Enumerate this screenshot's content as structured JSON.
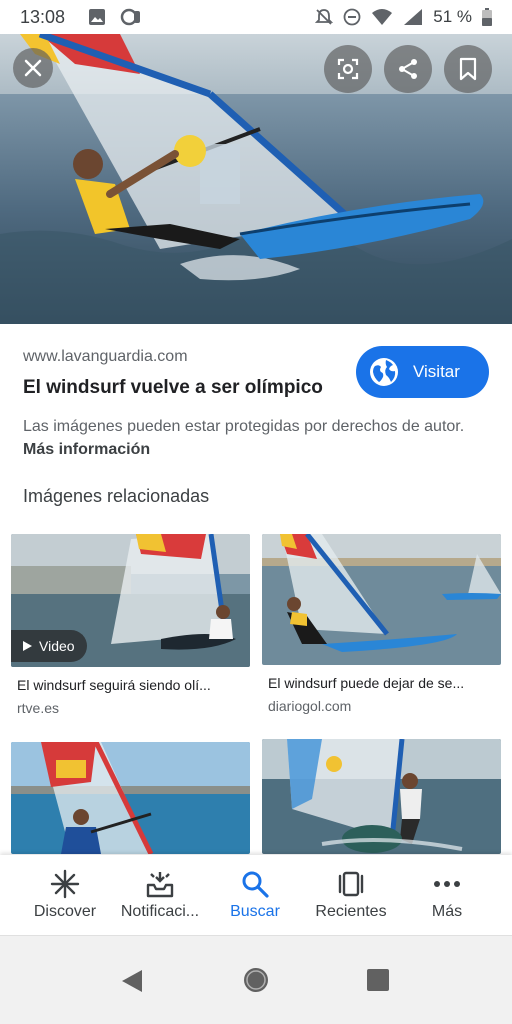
{
  "status_bar": {
    "time": "13:08",
    "battery_percent": "51 %"
  },
  "viewer": {
    "close_icon": "close-icon",
    "actions": [
      "lens-icon",
      "share-icon",
      "bookmark-icon"
    ]
  },
  "result": {
    "source": "www.lavanguardia.com",
    "title": "El windsurf vuelve a ser olímpico",
    "visit_label": "Visitar",
    "copyright_text": "Las imágenes pueden estar protegidas por derechos de autor.",
    "more_info_label": "Más información"
  },
  "related": {
    "heading": "Imágenes relacionadas",
    "items": [
      {
        "title": "El windsurf seguirá siendo olí...",
        "source": "rtve.es",
        "badge": "Video"
      },
      {
        "title": "El windsurf puede dejar de se...",
        "source": "diariogol.com"
      },
      {
        "title": "",
        "source": ""
      },
      {
        "title": "",
        "source": ""
      }
    ]
  },
  "bottom_nav": {
    "items": [
      {
        "label": "Discover",
        "icon": "discover-icon"
      },
      {
        "label": "Notificaci...",
        "icon": "notifications-icon"
      },
      {
        "label": "Buscar",
        "icon": "search-icon",
        "active": true
      },
      {
        "label": "Recientes",
        "icon": "recents-icon"
      },
      {
        "label": "Más",
        "icon": "more-icon"
      }
    ]
  },
  "colors": {
    "accent": "#1a73e8",
    "text_primary": "#202124",
    "text_secondary": "#5f6368"
  }
}
